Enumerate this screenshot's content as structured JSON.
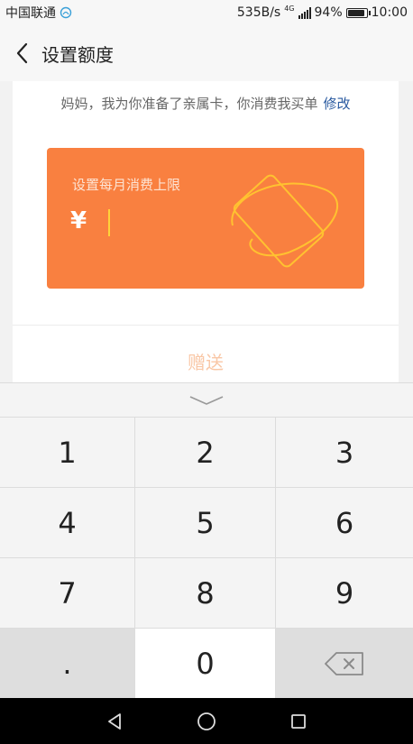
{
  "status_bar": {
    "carrier": "中国联通",
    "net_speed": "535B/s",
    "network_type": "4G",
    "battery_percent": "94%",
    "time": "10:00",
    "battery_level": 0.94
  },
  "header": {
    "title": "设置额度",
    "back_icon": "chevron-left-icon"
  },
  "message": {
    "text": "妈妈，我为你准备了亲属卡，你消费我买单",
    "edit_label": "修改"
  },
  "card": {
    "limit_label": "设置每月消费上限",
    "currency_symbol": "¥",
    "amount_value": "",
    "color": "#f98040",
    "illustration": "card-icon"
  },
  "actions": {
    "send_label": "赠送"
  },
  "keyboard": {
    "collapse_icon": "chevron-down-icon",
    "keys": [
      "1",
      "2",
      "3",
      "4",
      "5",
      "6",
      "7",
      "8",
      "9",
      ".",
      "0"
    ],
    "backspace_icon": "backspace-icon"
  },
  "nav_bar": {
    "icons": [
      "back-triangle-icon",
      "home-circle-icon",
      "recents-square-icon"
    ]
  }
}
